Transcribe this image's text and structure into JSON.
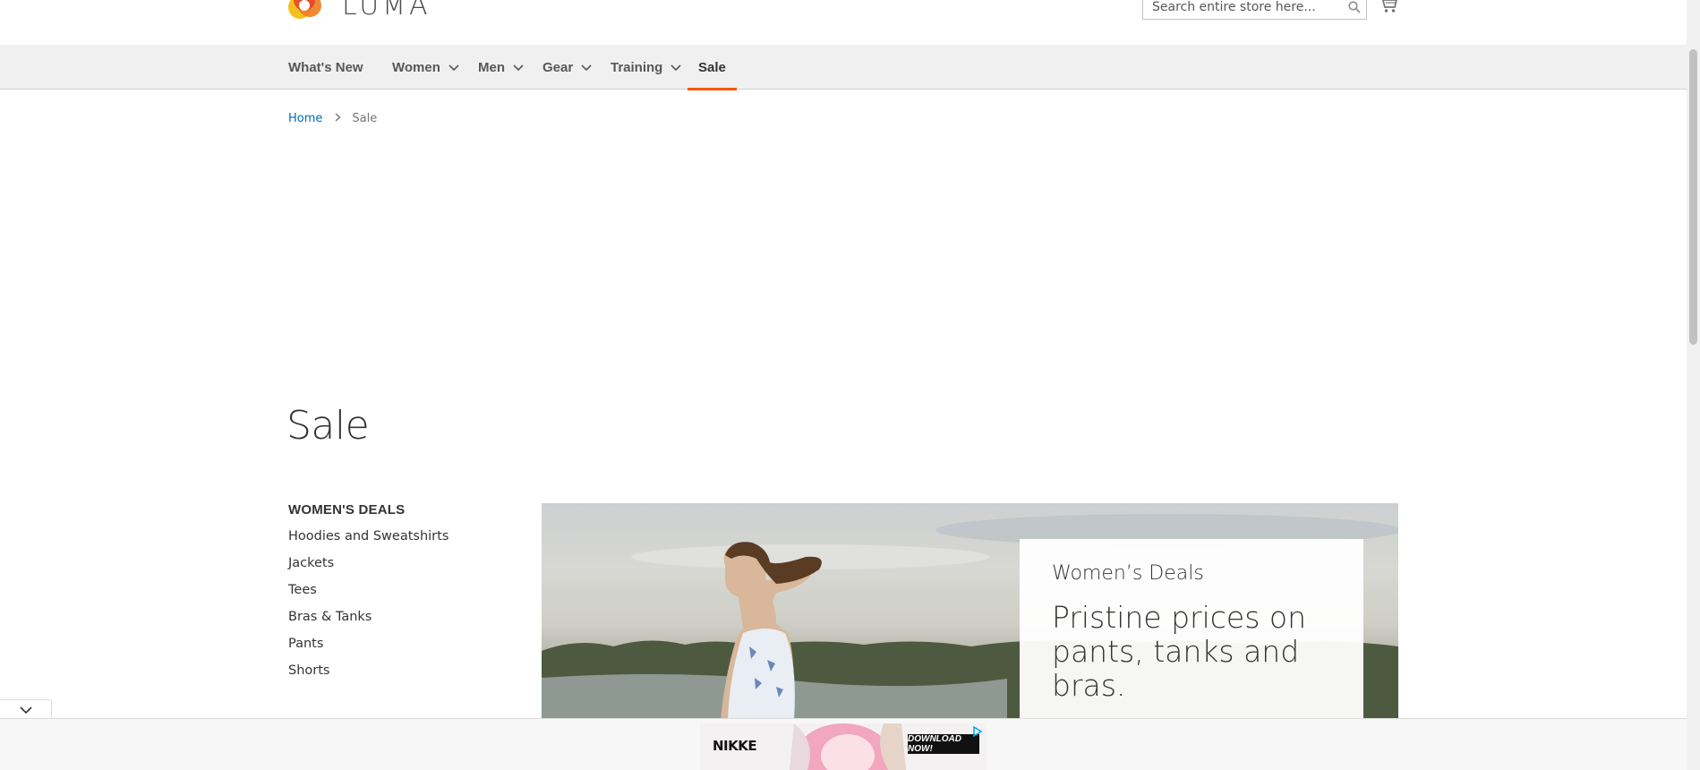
{
  "header": {
    "logo_text": "LUMA",
    "search_placeholder": "Search entire store here...",
    "search_icon": "search-icon",
    "cart_icon": "cart-icon"
  },
  "nav": {
    "items": [
      {
        "label": "What's New",
        "has_dropdown": false
      },
      {
        "label": "Women",
        "has_dropdown": true
      },
      {
        "label": "Men",
        "has_dropdown": true
      },
      {
        "label": "Gear",
        "has_dropdown": true
      },
      {
        "label": "Training",
        "has_dropdown": true
      },
      {
        "label": "Sale",
        "has_dropdown": false,
        "active": true
      }
    ],
    "active_color": "#ff5501"
  },
  "breadcrumbs": {
    "home": "Home",
    "current": "Sale"
  },
  "page_title": "Sale",
  "sidebar": {
    "heading": "WOMEN'S DEALS",
    "links": [
      "Hoodies and Sweatshirts",
      "Jackets",
      "Tees",
      "Bras & Tanks",
      "Pants",
      "Shorts"
    ]
  },
  "banner": {
    "kicker": "Women’s Deals",
    "headline": "Pristine prices on pants, tanks and bras."
  },
  "ad": {
    "brand": "NIKKE",
    "cta": "DOWNLOAD NOW!",
    "toggle_icon": "chevron-down-icon"
  },
  "colors": {
    "link": "#006bb4",
    "nav_bg": "#f0f0f0",
    "accent": "#ff5501"
  }
}
